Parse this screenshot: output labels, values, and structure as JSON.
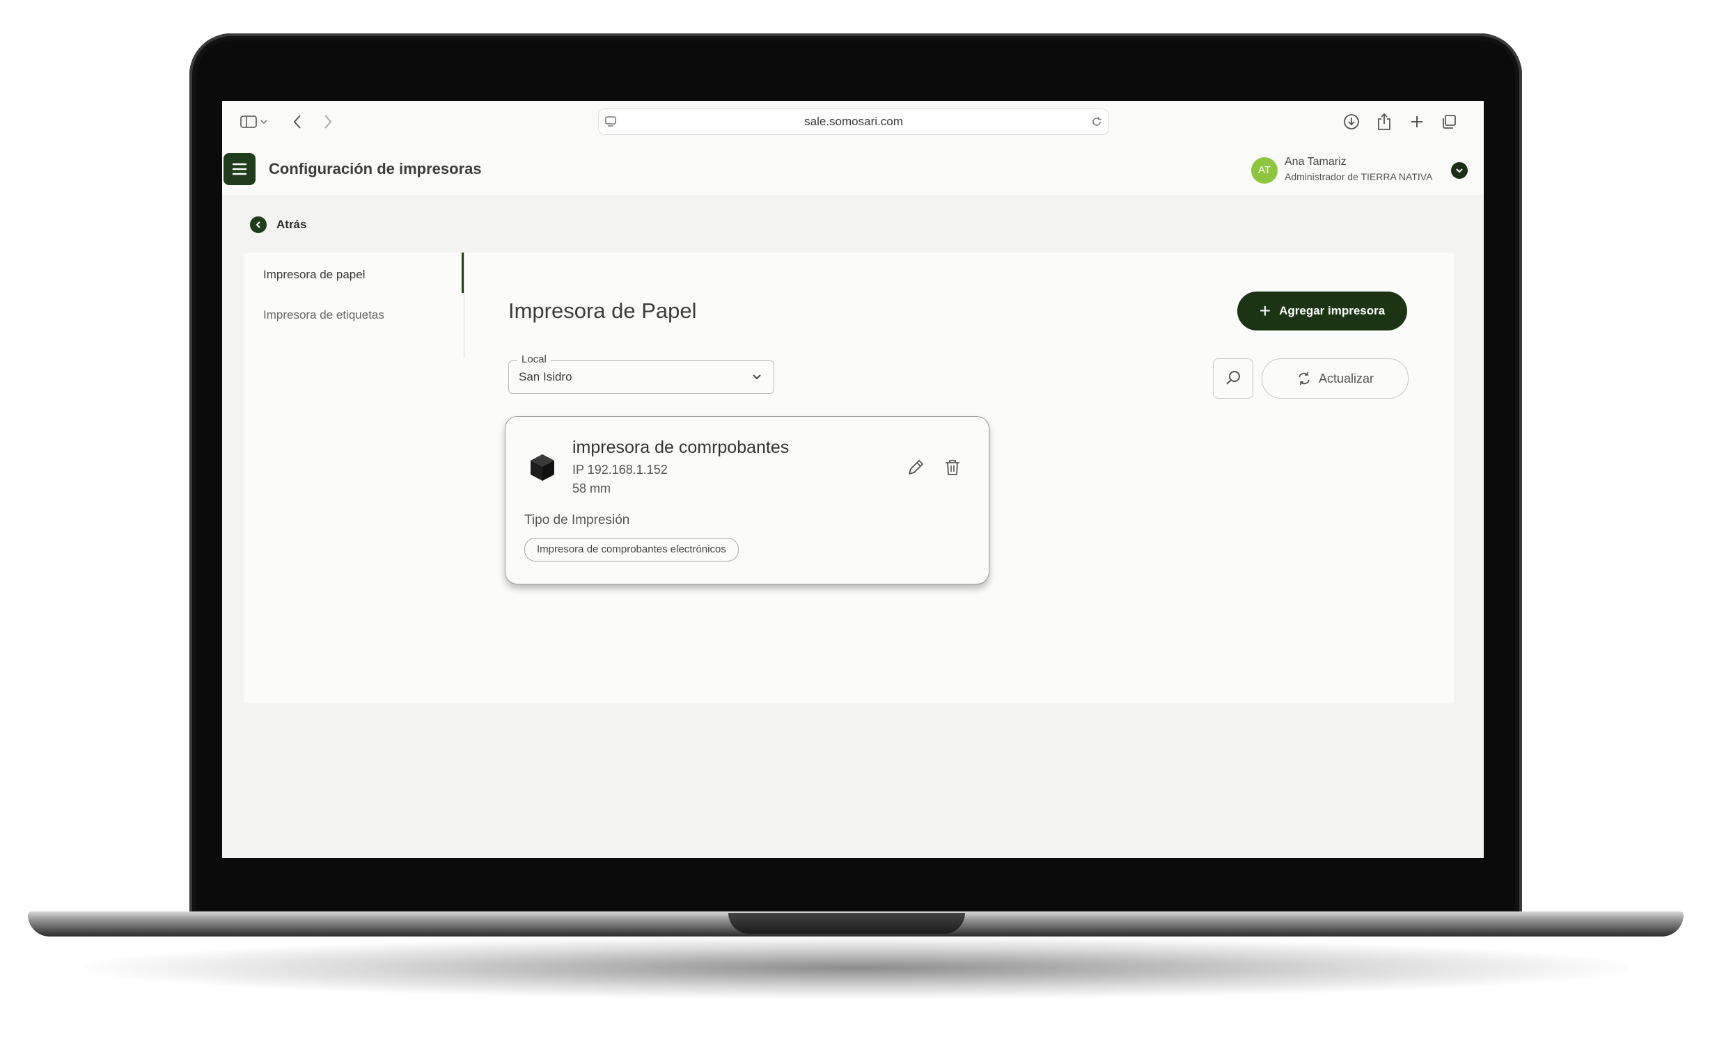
{
  "browser": {
    "url": "sale.somosari.com",
    "icons": [
      "sidebar-icon",
      "chevron-down-icon",
      "back-icon",
      "forward-icon",
      "site-settings-icon",
      "reload-icon",
      "download-icon",
      "share-icon",
      "new-tab-icon",
      "tabs-overview-icon"
    ]
  },
  "header": {
    "title": "Configuración de impresoras",
    "user": {
      "initials": "AT",
      "name": "Ana Tamariz",
      "role": "Administrador de TIERRA NATIVA"
    }
  },
  "nav": {
    "back_label": "Atrás"
  },
  "sidebar": {
    "items": [
      {
        "label": "Impresora de papel",
        "active": true
      },
      {
        "label": "Impresora de etiquetas",
        "active": false
      }
    ]
  },
  "main": {
    "title": "Impresora de Papel",
    "add_button": "Agregar impresora",
    "local_filter": {
      "label": "Local",
      "value": "San Isidro"
    },
    "refresh_button": "Actualizar",
    "printers": [
      {
        "name": "impresora de comrpobantes",
        "ip": "IP 192.168.1.152",
        "paper_width": "58 mm",
        "type_label": "Tipo de Impresión",
        "type_value": "Impresora de comprobantes electrónicos"
      }
    ]
  },
  "colors": {
    "brand_dark_green": "#1a3414",
    "avatar_green": "#8cc63f",
    "background": "#f3f3f1",
    "surface": "#fbfbfa"
  }
}
